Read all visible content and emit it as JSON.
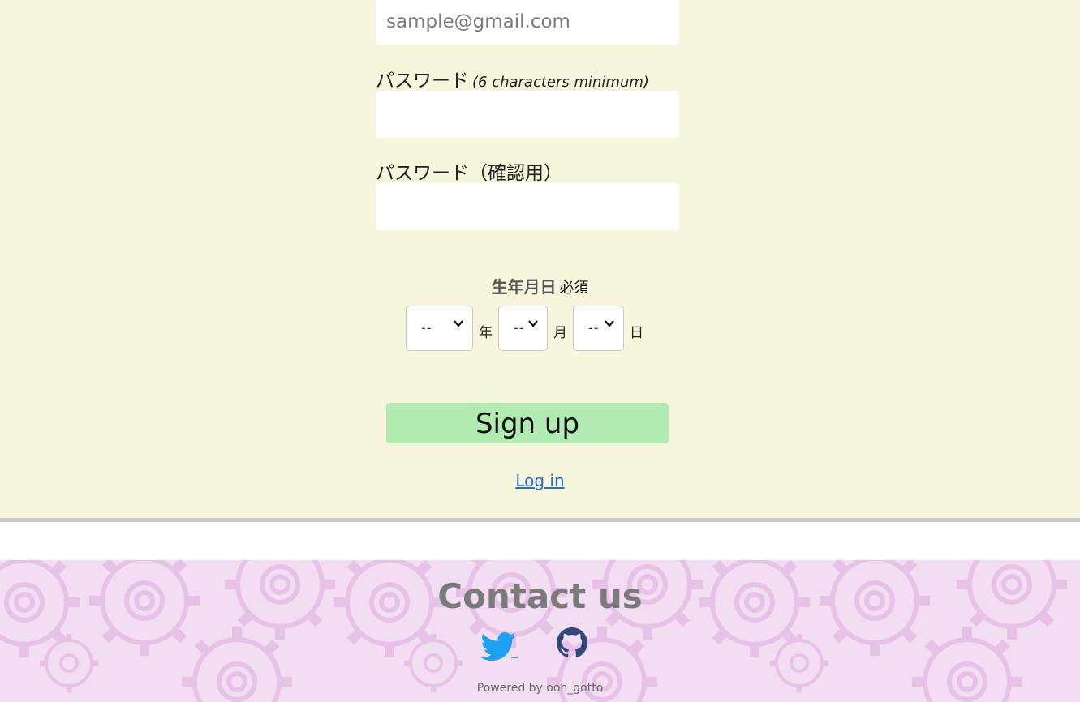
{
  "form": {
    "email_placeholder": "sample@gmail.com",
    "password_label": "パスワード",
    "password_note": "(6 characters minimum)",
    "password_confirm_label": "パスワード（確認用）",
    "birthdate_label": "生年月日",
    "required_label": "必須",
    "year_value": "--",
    "month_value": "--",
    "day_value": "--",
    "year_unit": "年",
    "month_unit": "月",
    "day_unit": "日",
    "signup_label": "Sign up",
    "login_label": "Log in"
  },
  "footer": {
    "title": "Contact us",
    "powered_by": "Powered by ooh_gotto"
  },
  "colors": {
    "form_background": "#f6f6dc",
    "signup_button": "#b2ebb2",
    "footer_background": "#f2ddf2",
    "twitter": "#1da1f2",
    "github": "#2f4a7a",
    "link": "#2a6bd8"
  }
}
